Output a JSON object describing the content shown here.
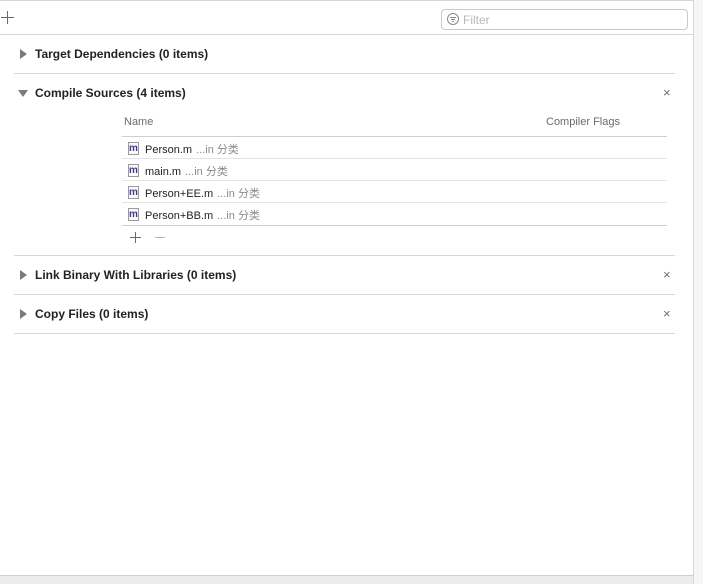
{
  "toolbar": {
    "add_icon": "plus-icon",
    "filter_icon": "filter-icon",
    "filter_placeholder": "Filter",
    "filter_value": ""
  },
  "phases": [
    {
      "title": "Target Dependencies (0 items)",
      "expanded": false
    },
    {
      "title": "Compile Sources (4 items)",
      "expanded": true,
      "close_icon": "×",
      "columns": [
        "Name",
        "Compiler Flags"
      ],
      "files": [
        {
          "icon": "m",
          "name": "Person.m",
          "location": "...in 分类",
          "flags": ""
        },
        {
          "icon": "m",
          "name": "main.m",
          "location": "...in 分类",
          "flags": ""
        },
        {
          "icon": "m",
          "name": "Person+EE.m",
          "location": "...in 分类",
          "flags": ""
        },
        {
          "icon": "m",
          "name": "Person+BB.m",
          "location": "...in 分类",
          "flags": ""
        }
      ]
    },
    {
      "title": "Link Binary With Libraries (0 items)",
      "expanded": false,
      "close_icon": "×"
    },
    {
      "title": "Copy Files (0 items)",
      "expanded": false,
      "close_icon": "×"
    }
  ]
}
